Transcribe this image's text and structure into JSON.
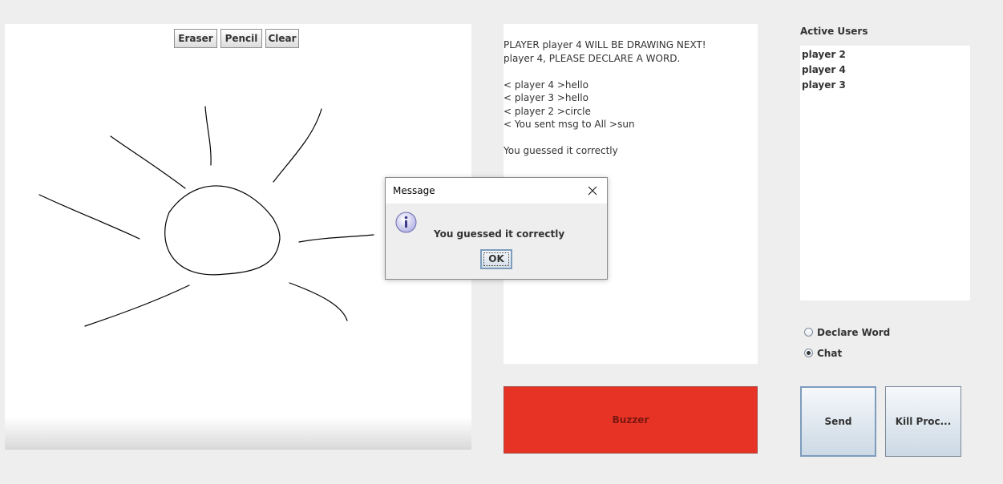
{
  "canvas": {
    "tools": {
      "eraser_label": "Eraser",
      "pencil_label": "Pencil",
      "clear_label": "Clear"
    }
  },
  "chat": {
    "lines": [
      "PLAYER player 4 WILL BE DRAWING NEXT!",
      "player 4, PLEASE DECLARE A WORD.",
      "",
      "< player 4 >hello",
      "< player 3 >hello",
      "< player 2 >circle",
      "< You sent msg to All >sun",
      "",
      "You guessed it correctly"
    ]
  },
  "buzzer": {
    "label": "Buzzer",
    "color": "#e63325"
  },
  "users": {
    "title": "Active Users",
    "items": [
      "player 2",
      "player 4",
      "player 3"
    ]
  },
  "mode": {
    "declare_word_label": "Declare Word",
    "chat_label": "Chat",
    "selected": "Chat"
  },
  "actions": {
    "send_label": "Send",
    "kill_label": "Kill Proc..."
  },
  "dialog": {
    "title": "Message",
    "message": "You guessed it correctly",
    "ok_label": "OK",
    "icon": "info-icon",
    "close_icon": "close-icon"
  }
}
